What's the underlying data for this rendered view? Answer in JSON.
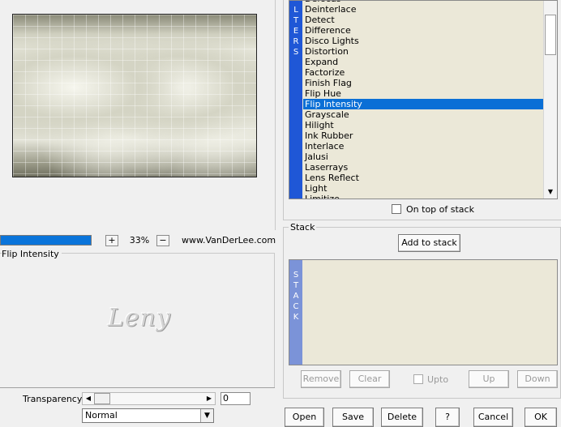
{
  "zoom": {
    "progress_percent": 100,
    "plus": "+",
    "minus": "−",
    "value": "33%",
    "site": "www.VanDerLee.com"
  },
  "settings": {
    "title": "Flip Intensity",
    "signature": "Leny"
  },
  "transparency": {
    "label": "Transparency",
    "value": "0",
    "left_arrow": "◀",
    "right_arrow": "▶",
    "blend_mode": "Normal",
    "blend_arrow": "▼"
  },
  "filters": {
    "stripe_letters": [
      "L",
      "T",
      "E",
      "R",
      "S"
    ],
    "items": [
      "Defocus",
      "Deinterlace",
      "Detect",
      "Difference",
      "Disco Lights",
      "Distortion",
      "Expand",
      "Factorize",
      "Finish Flag",
      "Flip Hue",
      "Flip Intensity",
      "Grayscale",
      "Hilight",
      "Ink Rubber",
      "Interlace",
      "Jalusi",
      "Laserrays",
      "Lens Reflect",
      "Light",
      "Limitize"
    ],
    "selected": "Flip Intensity",
    "scroll_down": "▼",
    "on_top_label": "On top of stack"
  },
  "stack": {
    "title": "Stack",
    "add_label": "Add to stack",
    "stripe_letters": [
      "S",
      "T",
      "A",
      "C",
      "K"
    ],
    "remove_label": "Remove",
    "clear_label": "Clear",
    "upto_label": "Upto",
    "up_label": "Up",
    "down_label": "Down"
  },
  "actions": {
    "open": "Open",
    "save": "Save",
    "delete": "Delete",
    "help": "?",
    "cancel": "Cancel",
    "ok": "OK"
  },
  "colors": {
    "accent": "#0a74da",
    "filter_stripe": "#1f57d6",
    "stack_stripe": "#7b93d8",
    "list_bg": "#ebe8d8"
  }
}
